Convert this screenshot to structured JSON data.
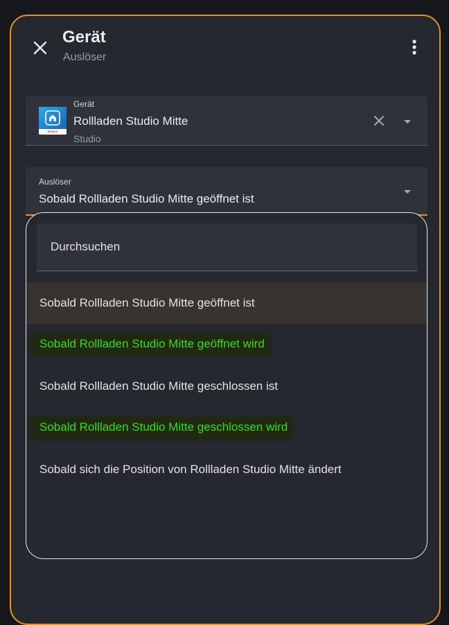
{
  "dialog": {
    "title": "Gerät",
    "subtitle": "Auslöser",
    "close_icon": "close-icon",
    "more_icon": "more-vert-icon",
    "accent_color": "#e8921c"
  },
  "device_field": {
    "label": "Gerät",
    "value": "Rollladen Studio Mitte",
    "area": "Studio",
    "brand_text": "BOSCH",
    "thumb_icon": "home-icon",
    "clear_icon": "clear-icon",
    "dropdown_icon": "caret-down-icon"
  },
  "trigger_field": {
    "label": "Auslöser",
    "value": "Sobald Rollladen Studio Mitte geöffnet ist",
    "dropdown_icon": "caret-down-icon"
  },
  "menu": {
    "search_placeholder": "Durchsuchen",
    "highlight_color": "#3dd91b",
    "options": [
      {
        "label": "Sobald Rollladen Studio Mitte geöffnet ist",
        "selected": true,
        "highlighted": false
      },
      {
        "label": "Sobald Rollladen Studio Mitte geöffnet wird",
        "selected": false,
        "highlighted": true
      },
      {
        "label": "Sobald Rollladen Studio Mitte geschlossen ist",
        "selected": false,
        "highlighted": false
      },
      {
        "label": "Sobald Rollladen Studio Mitte geschlossen wird",
        "selected": false,
        "highlighted": true
      },
      {
        "label": "Sobald sich die Position von Rollladen Studio Mitte ändert",
        "selected": false,
        "highlighted": false
      }
    ]
  }
}
